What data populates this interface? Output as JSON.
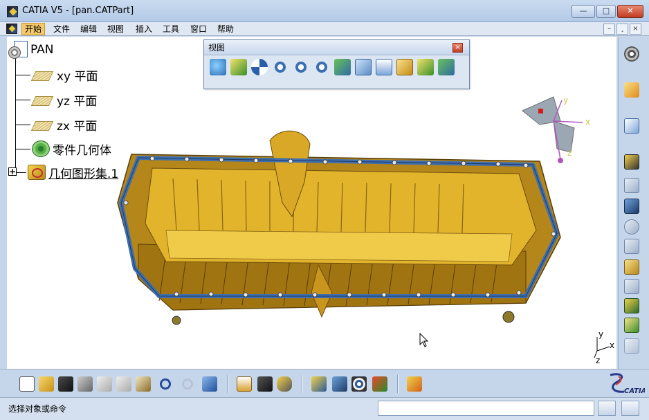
{
  "window": {
    "title": "CATIA V5 - [pan.CATPart]",
    "minimize_label": "—",
    "restore_label": "□",
    "close_label": "✕"
  },
  "menu": {
    "items": [
      {
        "label": "开始"
      },
      {
        "label": "文件"
      },
      {
        "label": "编辑"
      },
      {
        "label": "视图"
      },
      {
        "label": "插入"
      },
      {
        "label": "工具"
      },
      {
        "label": "窗口"
      },
      {
        "label": "帮助"
      }
    ],
    "mdi_min": "–",
    "mdi_restore": "¸",
    "mdi_close": "×"
  },
  "tree": {
    "root": "PAN",
    "nodes": [
      {
        "label": "xy 平面"
      },
      {
        "label": "yz 平面"
      },
      {
        "label": "zx 平面"
      },
      {
        "label": "零件几何体"
      },
      {
        "label": "几何图形集.1"
      }
    ]
  },
  "view_toolbar": {
    "title": "视图",
    "close_label": "×",
    "tools": [
      "fly-mode-icon",
      "fit-all-icon",
      "pan-icon",
      "rotate-icon",
      "zoom-in-icon",
      "zoom-out-icon",
      "normal-view-icon",
      "multi-view-icon",
      "iso-view-icon",
      "shading-icon",
      "hide-show-icon",
      "swap-visible-space-icon"
    ]
  },
  "compass": {
    "x_label": "x",
    "y_label": "y",
    "z_label": "z"
  },
  "triad": {
    "x_label": "x",
    "y_label": "y",
    "z_label": "z"
  },
  "status": {
    "prompt": "选择对象或命令",
    "command_value": ""
  },
  "colors": {
    "title_bar": "#c9dbf0",
    "menu_active": "#f3c96b",
    "part_gold": "#c99a1c",
    "flange_blue": "#3f6fae"
  }
}
